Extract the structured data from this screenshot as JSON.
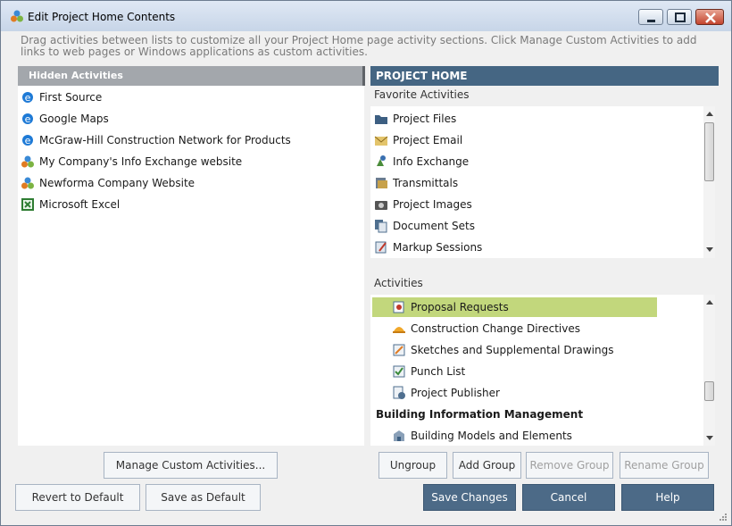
{
  "window": {
    "title": "Edit Project Home Contents"
  },
  "description": "Drag activities between lists to customize all your Project Home page activity sections.  Click Manage Custom Activities to add links to web pages or Windows applications as custom activities.",
  "hidden": {
    "header": "Hidden Activities",
    "items": [
      {
        "label": "First Source",
        "icon": "internet-explorer-icon"
      },
      {
        "label": "Google Maps",
        "icon": "internet-explorer-icon"
      },
      {
        "label": "McGraw-Hill Construction Network for Products",
        "icon": "internet-explorer-icon"
      },
      {
        "label": "My Company's Info Exchange website",
        "icon": "newforma-icon"
      },
      {
        "label": "Newforma Company Website",
        "icon": "newforma-icon"
      },
      {
        "label": "Microsoft Excel",
        "icon": "excel-icon"
      }
    ]
  },
  "project_home": {
    "header": "PROJECT HOME",
    "favorites_label": "Favorite Activities",
    "favorites": [
      {
        "label": "Project Files",
        "icon": "folder-icon"
      },
      {
        "label": "Project Email",
        "icon": "email-icon"
      },
      {
        "label": "Info Exchange",
        "icon": "satellite-icon"
      },
      {
        "label": "Transmittals",
        "icon": "transmittal-icon"
      },
      {
        "label": "Project Images",
        "icon": "camera-icon"
      },
      {
        "label": "Document Sets",
        "icon": "document-sets-icon"
      },
      {
        "label": "Markup Sessions",
        "icon": "markup-icon"
      }
    ],
    "activities_label": "Activities",
    "activities": [
      {
        "label": "Proposal Requests",
        "icon": "proposal-icon",
        "selected": true
      },
      {
        "label": "Construction Change Directives",
        "icon": "hard-hat-icon"
      },
      {
        "label": "Sketches and Supplemental Drawings",
        "icon": "sketch-icon"
      },
      {
        "label": "Punch List",
        "icon": "punch-list-icon"
      },
      {
        "label": "Project Publisher",
        "icon": "publisher-icon"
      }
    ],
    "bim_group": "Building Information Management",
    "bim_items": [
      {
        "label": "Building Models and Elements",
        "icon": "building-model-icon"
      }
    ]
  },
  "buttons": {
    "manage_custom": "Manage Custom Activities...",
    "ungroup": "Ungroup",
    "add_group": "Add Group",
    "remove_group": "Remove Group",
    "rename_group": "Rename Group",
    "revert": "Revert to Default",
    "save_default": "Save as Default",
    "save_changes": "Save Changes",
    "cancel": "Cancel",
    "help": "Help"
  },
  "colors": {
    "project_home_header": "#456683",
    "hidden_header": "#a3a7ac",
    "selected_row": "#c2d77c",
    "primary_button": "#4c6a87"
  }
}
